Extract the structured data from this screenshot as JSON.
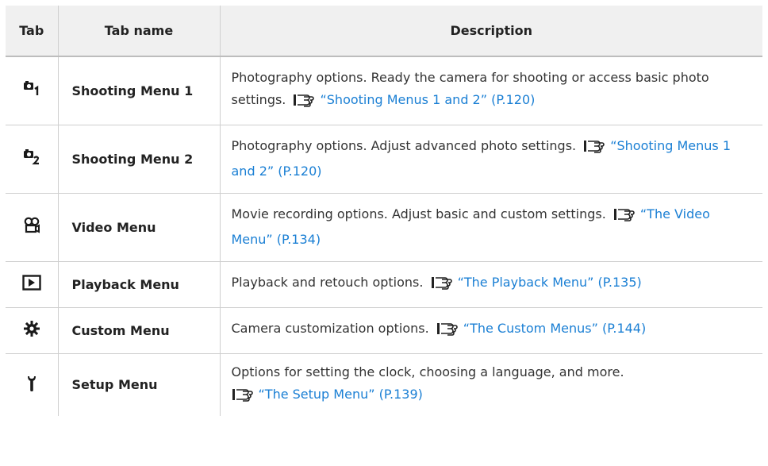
{
  "table": {
    "headers": {
      "tab": "Tab",
      "name": "Tab name",
      "description": "Description"
    },
    "rows": [
      {
        "icon": "camera-1-icon",
        "name": "Shooting Menu 1",
        "desc": "Photography options. Ready the camera for shooting or access basic photo settings.",
        "link": "“Shooting Menus 1 and 2” (P.120)"
      },
      {
        "icon": "camera-2-icon",
        "name": "Shooting Menu 2",
        "desc": "Photography options. Adjust advanced photo settings.",
        "link": "“Shooting Menus 1 and 2” (P.120)"
      },
      {
        "icon": "video-camera-icon",
        "name": "Video Menu",
        "desc": "Movie recording options. Adjust basic and custom settings.",
        "link": "“The Video Menu” (P.134)"
      },
      {
        "icon": "playback-icon",
        "name": "Playback Menu",
        "desc": "Playback and retouch options.",
        "link": "“The Playback Menu” (P.135)"
      },
      {
        "icon": "gear-icon",
        "name": "Custom Menu",
        "desc": "Camera customization options.",
        "link": "“The Custom Menus” (P.144)"
      },
      {
        "icon": "wrench-icon",
        "name": "Setup Menu",
        "desc": "Options for setting the clock, choosing a language, and more.",
        "link": "“The Setup Menu” (P.139)"
      }
    ]
  },
  "reference_icon": "page-reference-icon",
  "colors": {
    "link": "#1a7fd4",
    "header_bg": "#f0f0f0",
    "border": "#cfcfcf"
  }
}
